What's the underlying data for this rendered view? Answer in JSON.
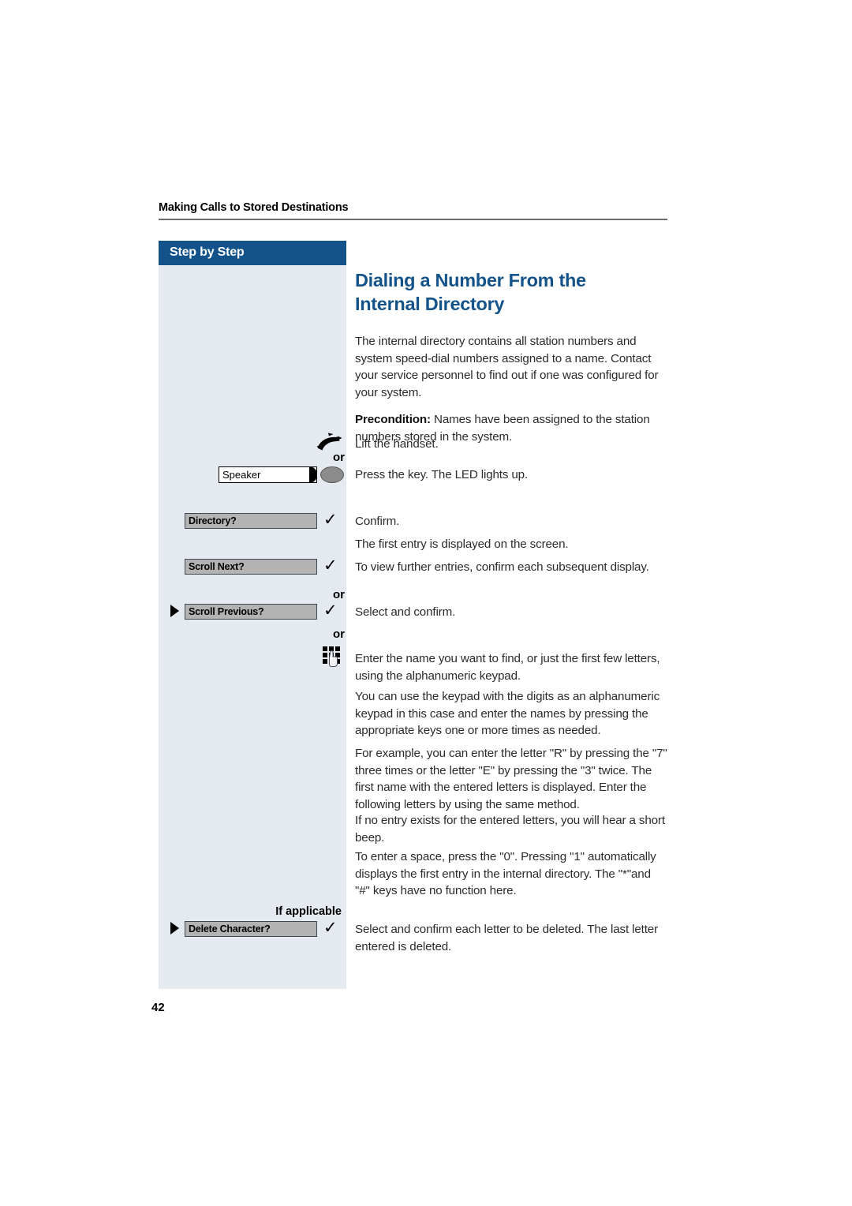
{
  "document": {
    "running_header": "Making Calls to Stored Destinations",
    "page_number": "42"
  },
  "sidebar": {
    "title": "Step by Step",
    "if_applicable_label": "If applicable",
    "or_1": "or",
    "or_2": "or",
    "or_3": "or",
    "keys": [
      {
        "name": "handset",
        "type": "icon",
        "label": ""
      },
      {
        "name": "speaker",
        "type": "label-key",
        "label": "Speaker"
      },
      {
        "name": "directory",
        "type": "softkey",
        "label": "Directory?"
      },
      {
        "name": "scroll-next",
        "type": "softkey",
        "label": "Scroll Next?"
      },
      {
        "name": "scroll-previous",
        "type": "softkey",
        "label": "Scroll Previous?"
      },
      {
        "name": "keypad",
        "type": "icon",
        "label": ""
      },
      {
        "name": "delete-character",
        "type": "softkey",
        "label": "Delete Character?"
      }
    ]
  },
  "main": {
    "title": "Dialing a Number From the Internal Directory",
    "intro": "The internal directory contains all station numbers and system speed-dial numbers assigned to a name. Contact your service personnel to find out if one was configured for your system.",
    "precondition_label": "Precondition:",
    "precondition_text": " Names have been assigned to the station numbers stored in the system.",
    "steps": [
      {
        "text": "Lift the handset."
      },
      {
        "text": "Press the key. The LED lights up."
      },
      {
        "text": "Confirm."
      },
      {
        "text": "The first entry is displayed on the screen."
      },
      {
        "text": "To view further entries, confirm each subsequent display."
      },
      {
        "text": "Select and confirm."
      },
      {
        "text": "Enter the name you want to find, or just the first few letters, using the alphanumeric keypad."
      },
      {
        "text": "You can use the keypad with the digits as an alphanumeric keypad in this case and enter the names by pressing the appropriate keys one or more times as needed."
      },
      {
        "text": "For example, you can enter the letter \"R\" by pressing the \"7\" three times or the letter \"E\" by pressing the \"3\" twice. The first name with the entered letters is displayed. Enter the following letters by using the same method."
      },
      {
        "text": "If no entry exists for the entered letters, you will hear a short beep."
      },
      {
        "text": "To enter a space, press the \"0\". Pressing \"1\" automatically displays the first entry in the internal directory. The \"*\"and \"#\" keys have no function here."
      },
      {
        "text": "Select and confirm each letter to be deleted. The last letter entered is deleted."
      }
    ]
  },
  "colors": {
    "accent_blue": "#13538a",
    "sidebar_bg": "#e4eaf0",
    "softkey_gray": "#b3b3b3",
    "text": "#2b2b2b"
  }
}
